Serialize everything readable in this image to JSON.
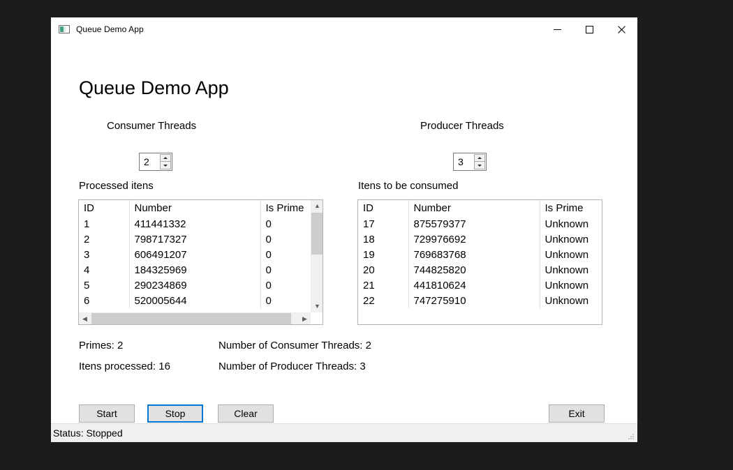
{
  "window": {
    "title": "Queue Demo App",
    "icon": "app-window-icon",
    "controls": {
      "minimize": "minimize-icon",
      "maximize": "maximize-icon",
      "close": "close-icon"
    }
  },
  "heading": "Queue Demo App",
  "threads": {
    "consumer_label": "Consumer Threads",
    "consumer_value": "2",
    "producer_label": "Producer Threads",
    "producer_value": "3"
  },
  "processed": {
    "caption": "Processed itens",
    "columns": [
      "ID",
      "Number",
      "Is Prime"
    ],
    "rows": [
      [
        "1",
        "411441332",
        "0"
      ],
      [
        "2",
        "798717327",
        "0"
      ],
      [
        "3",
        "606491207",
        "0"
      ],
      [
        "4",
        "184325969",
        "0"
      ],
      [
        "5",
        "290234869",
        "0"
      ],
      [
        "6",
        "520005644",
        "0"
      ]
    ]
  },
  "queued": {
    "caption": "Itens to be consumed",
    "columns": [
      "ID",
      "Number",
      "Is Prime"
    ],
    "rows": [
      [
        "17",
        "875579377",
        "Unknown"
      ],
      [
        "18",
        "729976692",
        "Unknown"
      ],
      [
        "19",
        "769683768",
        "Unknown"
      ],
      [
        "20",
        "744825820",
        "Unknown"
      ],
      [
        "21",
        "441810624",
        "Unknown"
      ],
      [
        "22",
        "747275910",
        "Unknown"
      ]
    ]
  },
  "stats": {
    "primes": "Primes: 2",
    "processed": "Itens processed: 16",
    "consumer_threads": "Number of Consumer Threads: 2",
    "producer_threads": "Number of Producer Threads: 3"
  },
  "buttons": {
    "start": "Start",
    "stop": "Stop",
    "clear": "Clear",
    "exit": "Exit"
  },
  "statusbar": {
    "text": "Status: Stopped"
  },
  "colors": {
    "focus_blue": "#0078d7",
    "window_bg": "#ffffff",
    "desktop_bg": "#1c1c1c",
    "button_face": "#e1e1e1",
    "statusbar_bg": "#f0f0f0"
  }
}
